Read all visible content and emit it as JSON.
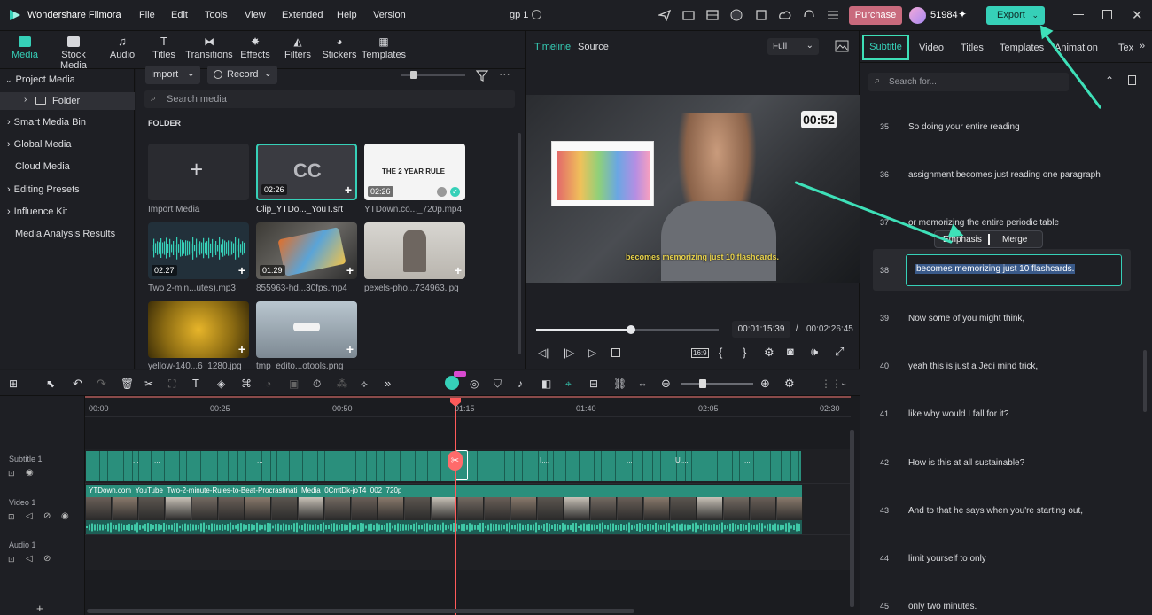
{
  "app": {
    "title": "Wondershare Filmora",
    "project_name": "gp 1",
    "menu": [
      "File",
      "Edit",
      "Tools",
      "View",
      "Extended",
      "Help",
      "Version"
    ],
    "purchase_label": "Purchase",
    "credits": "51984",
    "export_label": "Export",
    "accent_color": "#36d0b8",
    "purchase_color": "#c96a7d"
  },
  "media_tabs": [
    "Media",
    "Stock Media",
    "Audio",
    "Titles",
    "Transitions",
    "Effects",
    "Filters",
    "Stickers",
    "Templates"
  ],
  "sidebar": {
    "items": [
      "Project Media",
      "Folder",
      "Smart Media Bin",
      "Global Media",
      "Cloud Media",
      "Editing Presets",
      "Influence Kit",
      "Media Analysis Results"
    ]
  },
  "media": {
    "import_label": "Import",
    "record_label": "Record",
    "search_placeholder": "Search media",
    "folder_heading": "FOLDER",
    "items": [
      {
        "caption": "Import Media",
        "duration": ""
      },
      {
        "caption": "Clip_YTDo..._YouT.srt",
        "duration": "02:26",
        "thumb_text": "CC"
      },
      {
        "caption": "YTDown.co..._720p.mp4",
        "duration": "02:26",
        "thumb_text": "THE 2 YEAR RULE"
      },
      {
        "caption": "Two 2-min...utes).mp3",
        "duration": "02:27"
      },
      {
        "caption": "855963-hd...30fps.mp4",
        "duration": "01:29"
      },
      {
        "caption": "pexels-pho...734963.jpg",
        "duration": ""
      },
      {
        "caption": "yellow-140...6_1280.jpg",
        "duration": ""
      },
      {
        "caption": "tmp_edito...otools.png",
        "duration": ""
      }
    ]
  },
  "player": {
    "tabs": [
      "Timeline",
      "Source"
    ],
    "quality": "Full",
    "overlay_timer": "00:52",
    "caption_text": "becomes memorizing just 10 flashcards.",
    "current_time": "00:01:15:39",
    "separator": "/",
    "total_time": "00:02:26:45",
    "progress": 0.52
  },
  "subtitle_panel": {
    "tabs": [
      "Subtitle",
      "Video",
      "Titles",
      "Templates",
      "Animation",
      "Tex"
    ],
    "search_placeholder": "Search for...",
    "popup": [
      "Emphasis",
      "Merge"
    ],
    "rows": [
      {
        "num": "35",
        "text": "So doing your entire reading"
      },
      {
        "num": "36",
        "text": "assignment becomes just reading one paragraph"
      },
      {
        "num": "37",
        "text": "or memorizing the entire periodic table"
      },
      {
        "num": "38",
        "text": "becomes memorizing just 10 flashcards."
      },
      {
        "num": "39",
        "text": "Now some of you might think,"
      },
      {
        "num": "40",
        "text": "yeah this is just a Jedi mind trick,"
      },
      {
        "num": "41",
        "text": "like why would I fall for it?"
      },
      {
        "num": "42",
        "text": "How is this at all sustainable?"
      },
      {
        "num": "43",
        "text": "And to that he says when you're starting out,"
      },
      {
        "num": "44",
        "text": "limit yourself to only"
      },
      {
        "num": "45",
        "text": "only two minutes."
      }
    ]
  },
  "timeline": {
    "ruler": [
      "00:00",
      "00:25",
      "00:50",
      "01:15",
      "01:40",
      "02:05",
      "02:30"
    ],
    "tracks": [
      "Subtitle 1",
      "Video 1",
      "Audio 1"
    ],
    "video_clip_label": "YTDown.com_YouTube_Two-2-minute-Rules-to-Beat-Procrastinati_Media_0CmtDk-joT4_002_720p",
    "subtitle_clip_labels": [
      "...",
      "...",
      "...",
      "I....",
      "...",
      "U....",
      "..."
    ],
    "playhead_color": "#ff5a5a"
  }
}
